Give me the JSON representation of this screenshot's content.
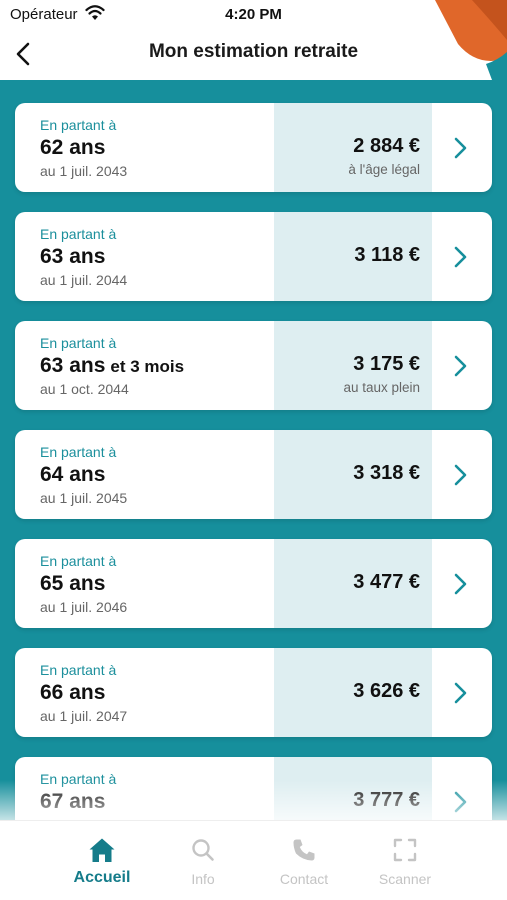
{
  "status_bar": {
    "carrier": "Opérateur",
    "time": "4:20 PM"
  },
  "header": {
    "title": "Mon estimation retraite"
  },
  "colors": {
    "teal_background": "#168f9c",
    "teal_text": "#1b8f9c",
    "card_amount_bg": "#deeef1",
    "deco_orange": "#e0672a"
  },
  "cards": [
    {
      "eyebrow": "En partant à",
      "age": "62 ans",
      "age_extra": "",
      "date": "au 1 juil. 2043",
      "amount": "2 884 €",
      "note": "à l'âge légal"
    },
    {
      "eyebrow": "En partant à",
      "age": "63 ans",
      "age_extra": "",
      "date": "au 1 juil. 2044",
      "amount": "3 118 €",
      "note": ""
    },
    {
      "eyebrow": "En partant à",
      "age": "63 ans",
      "age_extra": "et 3 mois",
      "date": "au 1 oct. 2044",
      "amount": "3 175 €",
      "note": "au taux plein"
    },
    {
      "eyebrow": "En partant à",
      "age": "64 ans",
      "age_extra": "",
      "date": "au 1 juil. 2045",
      "amount": "3 318 €",
      "note": ""
    },
    {
      "eyebrow": "En partant à",
      "age": "65 ans",
      "age_extra": "",
      "date": "au 1 juil. 2046",
      "amount": "3 477 €",
      "note": ""
    },
    {
      "eyebrow": "En partant à",
      "age": "66 ans",
      "age_extra": "",
      "date": "au 1 juil. 2047",
      "amount": "3 626 €",
      "note": ""
    },
    {
      "eyebrow": "En partant à",
      "age": "67 ans",
      "age_extra": "",
      "date": "",
      "amount": "3 777 €",
      "note": ""
    }
  ],
  "tab_bar": {
    "tabs": [
      {
        "label": "Accueil",
        "icon": "home-icon",
        "active": true
      },
      {
        "label": "Info",
        "icon": "search-icon",
        "active": false
      },
      {
        "label": "Contact",
        "icon": "phone-icon",
        "active": false
      },
      {
        "label": "Scanner",
        "icon": "scan-icon",
        "active": false
      }
    ]
  }
}
